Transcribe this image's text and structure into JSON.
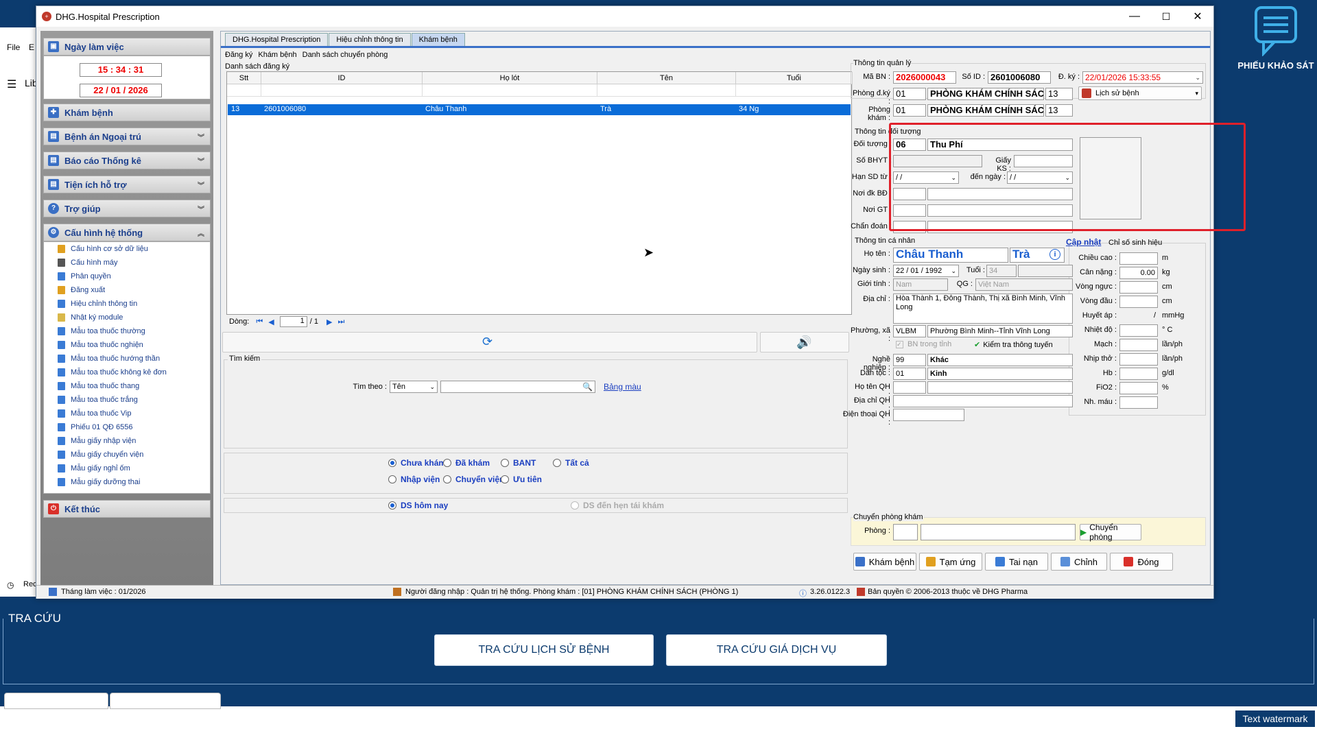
{
  "background": {
    "survey_label": "PHIẾU KHẢO SÁT",
    "menu_file": "File",
    "menu_e": "E",
    "lib_label": "Lib",
    "rec_label": "Rec",
    "tracuu_title": "TRA CỨU",
    "btn_history": "TRA CỨU LỊCH SỬ BỆNH",
    "btn_price": "TRA CỨU GIÁ DỊCH VỤ",
    "watermark": "Text watermark"
  },
  "window": {
    "title": "DHG.Hospital Prescription",
    "minimize": "—",
    "maximize": "☐",
    "close": "✕"
  },
  "nav": {
    "workday_header": "Ngày làm việc",
    "time": "15 : 34 : 31",
    "date": "22 / 01 / 2026",
    "sections": [
      "Khám bệnh",
      "Bệnh án Ngoại trú",
      "Báo cáo Thống kê",
      "Tiện ích hỗ trợ",
      "Trợ giúp",
      "Cấu hình hệ thống"
    ],
    "config_items": [
      "Cấu hình cơ sở dữ liệu",
      "Cấu hình máy",
      "Phân quyền",
      "Đăng xuất",
      "Hiệu chỉnh thông tin",
      "Nhật ký module",
      "Mẫu toa thuốc thường",
      "Mẫu toa thuốc nghiện",
      "Mẫu toa thuốc hướng thần",
      "Mẫu toa thuốc không kê đơn",
      "Mẫu toa thuốc thang",
      "Mẫu toa thuốc trắng",
      "Mẫu toa thuốc Vip",
      "Phiếu 01 QĐ 6556",
      "Mẫu giấy nhập viện",
      "Mẫu giấy chuyển viện",
      "Mẫu giấy nghỉ ốm",
      "Mẫu giấy dưỡng thai"
    ],
    "exit": "Kết thúc"
  },
  "tabs": [
    "DHG.Hospital Prescription",
    "Hiệu chỉnh thông tin",
    "Khám bệnh"
  ],
  "subtabs": [
    "Đăng ký",
    "Khám bệnh",
    "Danh sách chuyển phòng"
  ],
  "list": {
    "group_label": "Danh sách đăng ký",
    "columns": [
      "Stt",
      "ID",
      "Họ lót",
      "Tên",
      "Tuổi"
    ],
    "rows": [
      {
        "stt": "13",
        "id": "2601006080",
        "holot": "Châu Thanh",
        "ten": "Trà",
        "tuoi": "34 Ng"
      }
    ],
    "pager_label": "Dòng:",
    "page": "1",
    "page_total": "/   1"
  },
  "search": {
    "group_label": "Tìm kiếm",
    "by_label": "Tìm theo :",
    "by_value": "Tên",
    "color_link": "Bảng màu"
  },
  "filters": {
    "row1": [
      "Chưa khám",
      "Đã khám",
      "BANT",
      "Tất cả"
    ],
    "row2": [
      "Nhập viện",
      "Chuyển viện",
      "Ưu tiên"
    ],
    "today": "DS hôm nay",
    "recheck": "DS đến hẹn tái khám"
  },
  "admin": {
    "group_label": "Thông tin quản lý",
    "ma_bn_label": "Mã BN :",
    "ma_bn": "2026000043",
    "so_id_label": "Số ID :",
    "so_id": "2601006080",
    "dky_label": "Đ. ký :",
    "dky": "22/01/2026 15:33:55",
    "phong_dky_label": "Phòng đ.ký :",
    "phong_dky_code": "01",
    "phong_dky_name": "PHÒNG KHÁM CHÍNH SÁCH",
    "phong_dky_num": "13",
    "history_btn": "Lịch sử bệnh",
    "phong_kham_label": "Phòng khám :",
    "phong_kham_code": "01",
    "phong_kham_name": "PHÒNG KHÁM CHÍNH SÁCH",
    "phong_kham_num": "13"
  },
  "subject": {
    "group_label": "Thông tin đối tượng",
    "doi_tuong_label": "Đối tượng :",
    "doi_tuong_code": "06",
    "doi_tuong_name": "Thu Phí",
    "so_bhyt_label": "Số BHYT :",
    "giay_ks_label": "Giấy KS :",
    "han_sd_label": "Hạn SD từ :",
    "han_sd_from": " /    /",
    "den_ngay_label": "đến ngày :",
    "han_sd_to": " /    /",
    "noi_dk_label": "Nơi đk BĐ :",
    "noi_gt_label": "Nơi GT :",
    "chan_doan_label": "Chẩn đoán :"
  },
  "personal": {
    "group_label": "Thông tin cá nhân",
    "ho_ten_label": "Họ tên :",
    "ho": "Châu Thanh",
    "ten": "Trà",
    "ngay_sinh_label": "Ngày sinh :",
    "ngay_sinh": "22 / 01 / 1992",
    "tuoi_label": "Tuổi :",
    "tuoi": "34",
    "gioi_tinh_label": "Giới tính :",
    "gioi_tinh": "Nam",
    "qg_label": "QG :",
    "qg": "Việt Nam",
    "dia_chi_label": "Địa chỉ :",
    "dia_chi": "Hòa Thành 1, Đông Thành, Thị xã Bình Minh, Vĩnh Long",
    "phuong_label": "Phường, xã :",
    "phuong_code": "VLBM",
    "phuong_name": "Phường Bình Minh--Tỉnh Vĩnh Long",
    "bn_trong_tinh": "BN trong tỉnh",
    "kiem_tra": "Kiểm tra thông tuyến",
    "nghe_nghiep_label": "Nghề nghiệp :",
    "nghe_code": "99",
    "nghe_name": "Khác",
    "dan_toc_label": "Dân tộc :",
    "dan_toc_code": "01",
    "dan_toc_name": "Kinh",
    "ho_ten_qh_label": "Họ tên QH :",
    "dia_chi_qh_label": "Địa chỉ QH :",
    "dien_thoai_label": "Điện thoại QH :"
  },
  "vitals": {
    "update_link": "Cập nhật",
    "group_label": "Chỉ số sinh hiệu",
    "items": [
      {
        "label": "Chiều cao :",
        "value": "",
        "unit": "m"
      },
      {
        "label": "Cân nặng :",
        "value": "0.00",
        "unit": "kg"
      },
      {
        "label": "Vòng ngực :",
        "value": "",
        "unit": "cm"
      },
      {
        "label": "Vòng đầu :",
        "value": "",
        "unit": "cm"
      },
      {
        "label": "Huyết áp :",
        "value": "/",
        "unit": "mmHg"
      },
      {
        "label": "Nhiệt độ :",
        "value": "",
        "unit": "° C"
      },
      {
        "label": "Mạch :",
        "value": "",
        "unit": "lần/ph"
      },
      {
        "label": "Nhịp thở :",
        "value": "",
        "unit": "lần/ph"
      },
      {
        "label": "Hb :",
        "value": "",
        "unit": "g/dl"
      },
      {
        "label": "FiO2 :",
        "value": "",
        "unit": "%"
      },
      {
        "label": "Nh. máu :",
        "value": "",
        "unit": ""
      }
    ]
  },
  "transfer": {
    "group_label": "Chuyển phòng khám",
    "phong_label": "Phòng :",
    "btn": "Chuyển phòng"
  },
  "actions": [
    "Khám bệnh",
    "Tạm ứng",
    "Tai nạn",
    "Chỉnh",
    "Đóng"
  ],
  "status": {
    "month": "Tháng làm việc : 01/2026",
    "user": "Người đăng nhập : Quản trị hệ thống. Phòng khám : [01] PHÒNG KHÁM CHÍNH SÁCH (PHÒNG 1)",
    "version": "3.26.0122.3",
    "copyright": "Bản quyền © 2006-2013 thuộc về DHG Pharma"
  },
  "colors": {
    "accent": "#3a70c8",
    "highlight": "#e0202a",
    "selection": "#0a6cd8",
    "nav_text": "#1a3e8c"
  }
}
